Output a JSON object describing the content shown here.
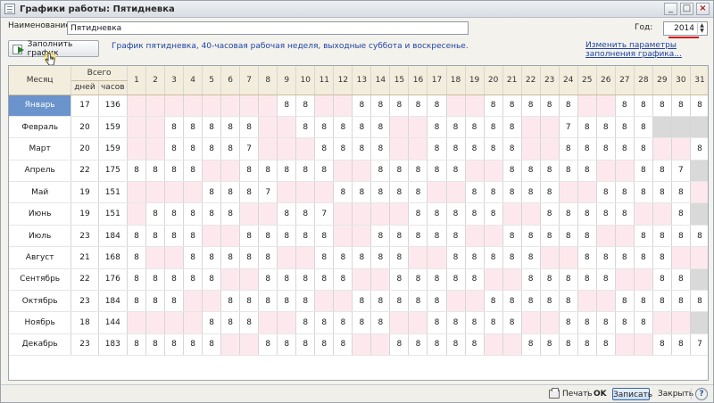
{
  "window": {
    "title": "Графики работы: Пятидневка"
  },
  "form": {
    "name_label": "Наименование:",
    "name_value": "Пятидневка",
    "year_label": "Год:",
    "year_value": "2014",
    "fill_button": "Заполнить график",
    "description": "График пятидневка, 40-часовая рабочая неделя, выходные суббота и воскресенье.",
    "change_link": "Изменить параметры заполнения графика..."
  },
  "table": {
    "col_month": "Месяц",
    "col_total": "Всего",
    "col_days": "дней",
    "col_hours": "часов",
    "day_numbers": [
      "1",
      "2",
      "3",
      "4",
      "5",
      "6",
      "7",
      "8",
      "9",
      "10",
      "11",
      "12",
      "13",
      "14",
      "15",
      "16",
      "17",
      "18",
      "19",
      "20",
      "21",
      "22",
      "23",
      "24",
      "25",
      "26",
      "27",
      "28",
      "29",
      "30",
      "31"
    ],
    "months": [
      {
        "name": "Январь",
        "days": "17",
        "hours": "136",
        "start": 2,
        "len": 31,
        "hol": [
          1,
          2,
          3,
          4,
          5,
          6,
          7,
          8
        ],
        "short": []
      },
      {
        "name": "Февраль",
        "days": "20",
        "hours": "159",
        "start": 5,
        "len": 28,
        "hol": [],
        "short": [
          {
            "d": 24,
            "v": "7"
          }
        ]
      },
      {
        "name": "Март",
        "days": "20",
        "hours": "159",
        "start": 5,
        "len": 31,
        "hol": [
          10
        ],
        "short": [
          {
            "d": 7,
            "v": "7"
          }
        ]
      },
      {
        "name": "Апрель",
        "days": "22",
        "hours": "175",
        "start": 1,
        "len": 30,
        "hol": [],
        "short": [
          {
            "d": 30,
            "v": "7"
          }
        ]
      },
      {
        "name": "Май",
        "days": "19",
        "hours": "151",
        "start": 3,
        "len": 31,
        "hol": [
          1,
          2,
          9
        ],
        "short": [
          {
            "d": 8,
            "v": "7"
          }
        ]
      },
      {
        "name": "Июнь",
        "days": "19",
        "hours": "151",
        "start": 6,
        "len": 30,
        "hol": [
          12,
          13
        ],
        "short": [
          {
            "d": 11,
            "v": "7"
          }
        ]
      },
      {
        "name": "Июль",
        "days": "23",
        "hours": "184",
        "start": 1,
        "len": 31,
        "hol": [],
        "short": []
      },
      {
        "name": "Август",
        "days": "21",
        "hours": "168",
        "start": 4,
        "len": 31,
        "hol": [],
        "short": []
      },
      {
        "name": "Сентябрь",
        "days": "22",
        "hours": "176",
        "start": 0,
        "len": 30,
        "hol": [],
        "short": []
      },
      {
        "name": "Октябрь",
        "days": "23",
        "hours": "184",
        "start": 2,
        "len": 31,
        "hol": [],
        "short": []
      },
      {
        "name": "Ноябрь",
        "days": "18",
        "hours": "144",
        "start": 5,
        "len": 30,
        "hol": [
          3,
          4
        ],
        "short": []
      },
      {
        "name": "Декабрь",
        "days": "23",
        "hours": "183",
        "start": 0,
        "len": 31,
        "hol": [],
        "short": [
          {
            "d": 31,
            "v": "7"
          }
        ]
      }
    ],
    "work_value": "8"
  },
  "footer": {
    "print": "Печать",
    "ok": "OK",
    "save": "Записать",
    "close": "Закрыть",
    "help": "?"
  }
}
